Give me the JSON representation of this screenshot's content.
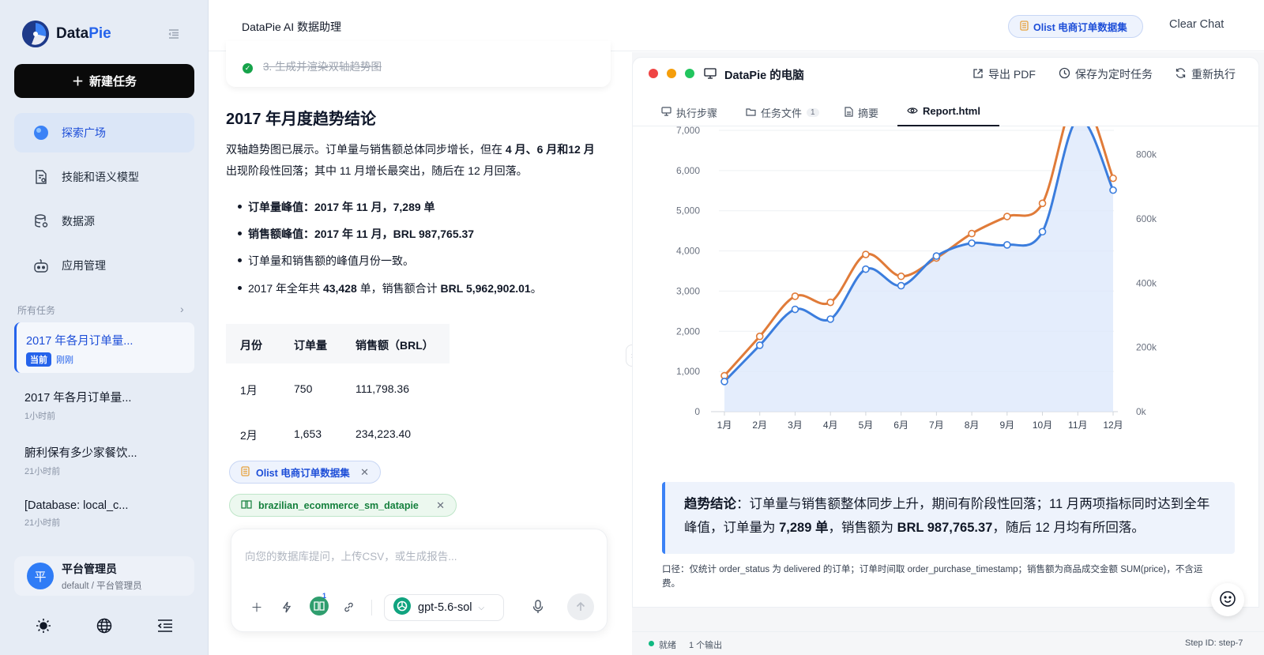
{
  "sidebar": {
    "logo_text_a": "Data",
    "logo_text_b": "Pie",
    "new_task": "新建任务",
    "nav": [
      {
        "label": "探索广场",
        "icon": "globe-icon"
      },
      {
        "label": "技能和语义模型",
        "icon": "document-settings-icon"
      },
      {
        "label": "数据源",
        "icon": "database-icon"
      },
      {
        "label": "应用管理",
        "icon": "robot-icon"
      }
    ],
    "section_label": "所有任务",
    "tasks": [
      {
        "title": "2017 年各月订单量...",
        "badge": "当前",
        "time": "刚刚"
      },
      {
        "title": "2017 年各月订单量...",
        "time": "1小时前"
      },
      {
        "title": "腑利保有多少家餐饮...",
        "time": "21小时前"
      },
      {
        "title": "[Database: local_c...",
        "time": "21小时前"
      }
    ],
    "user": {
      "avatar": "平",
      "name": "平台管理员",
      "sub": "default / 平台管理员"
    }
  },
  "header": {
    "title": "DataPie AI 数据助理",
    "dataset": "Olist 电商订单数据集",
    "clear_chat": "Clear Chat"
  },
  "chat": {
    "step": "3. 生成并渲染双轴趋势图",
    "heading": "2017 年月度趋势结论",
    "para_a": "双轴趋势图已展示。订单量与销售额总体同步增长，但在 ",
    "para_b": "4 月、6 月和12 月",
    "para_c": "出现阶段性回落；其中 11 月增长最突出，随后在 12 月回落。",
    "bullets": [
      {
        "bold": "订单量峰值：2017 年 11 月，7,289 单",
        "rest": ""
      },
      {
        "bold": "销售额峰值：2017 年 11 月，BRL 987,765.37",
        "rest": ""
      },
      {
        "bold": "",
        "rest": "订单量和销售额的峰值月份一致。"
      },
      {
        "bold": "",
        "rest": "2017 年全年共 ",
        "bold2": "43,428",
        "rest2": " 单，销售额合计 ",
        "bold3": "BRL 5,962,902.01",
        "rest3": "。"
      }
    ],
    "table": {
      "headers": [
        "月份",
        "订单量",
        "销售额（BRL）"
      ],
      "rows": [
        [
          "1月",
          "750",
          "111,798.36"
        ],
        [
          "2月",
          "1,653",
          "234,223.40"
        ]
      ]
    },
    "tags": [
      "Olist 电商订单数据集",
      "brazilian_ecommerce_sm_datapie"
    ],
    "input_placeholder": "向您的数据库提问，上传CSV，或生成报告...",
    "model": "gpt-5.6-sol",
    "tool_badge": "1"
  },
  "panel": {
    "window_title": "DataPie 的电脑",
    "actions": [
      "导出 PDF",
      "保存为定时任务",
      "重新执行"
    ],
    "tabs": [
      {
        "label": "执行步骤"
      },
      {
        "label": "任务文件",
        "count": "1"
      },
      {
        "label": "摘要"
      },
      {
        "label": "Report.html"
      }
    ],
    "callout_a": "趋势结论",
    "callout_b": "：订单量与销售额整体同步上升，期间有阶段性回落；11 月两项指标同时达到全年峰值，订单量为 ",
    "callout_c": "7,289 单",
    "callout_d": "，销售额为 ",
    "callout_e": "BRL 987,765.37",
    "callout_f": "，随后 12 月均有所回落。",
    "note": "口径：仅统计 order_status 为 delivered 的订单；订单时间取 order_purchase_timestamp；销售额为商品成交金额 SUM(price)，不含运费。",
    "status": "就绪",
    "outputs": "1 个输出",
    "step_id": "Step ID: step-7"
  },
  "chart_data": {
    "type": "line",
    "categories": [
      "1月",
      "2月",
      "3月",
      "4月",
      "5月",
      "6月",
      "7月",
      "8月",
      "9月",
      "10月",
      "11月",
      "12月"
    ],
    "series": [
      {
        "values": [
          750,
          1653,
          2546,
          2303,
          3546,
          3135,
          3872,
          4193,
          4150,
          4478,
          7289,
          5513
        ],
        "axis": "left",
        "color": "#3b7ddd"
      },
      {
        "values": [
          111798.36,
          234223.4,
          359000,
          340000,
          489000,
          421000,
          478000,
          554000,
          607000,
          648000,
          987765.37,
          726000
        ],
        "axis": "right",
        "color": "#e07b39"
      }
    ],
    "y_left": {
      "ticks": [
        "0",
        "1,000",
        "2,000",
        "3,000",
        "4,000",
        "5,000",
        "6,000",
        "7,000"
      ],
      "min": 0,
      "max": 7000
    },
    "y_right": {
      "ticks": [
        "0k",
        "200k",
        "400k",
        "600k",
        "800k"
      ],
      "min": 0,
      "max": 875000
    },
    "area_fill": "#dbe7fb"
  }
}
